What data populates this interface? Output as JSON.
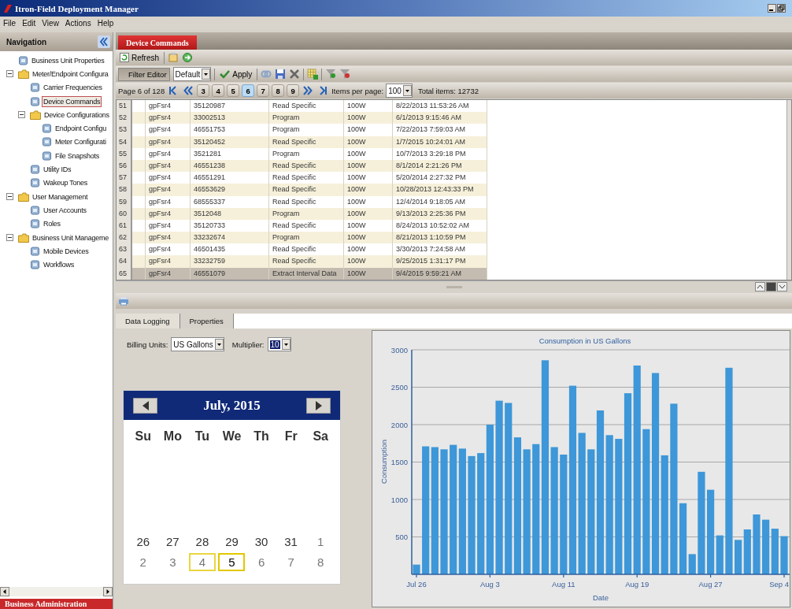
{
  "window": {
    "title": "Itron-Field Deployment Manager"
  },
  "menu": [
    "File",
    "Edit",
    "View",
    "Actions",
    "Help"
  ],
  "sidebar": {
    "title": "Navigation",
    "items": [
      {
        "label": "Business Unit Properties",
        "selected": false
      },
      {
        "label": "Meter/Endpoint Configura",
        "selected": false,
        "expanded": true,
        "children": [
          {
            "label": "Carrier Frequencies",
            "selected": false
          },
          {
            "label": "Device Commands",
            "selected": true
          },
          {
            "label": "Device Configurations",
            "selected": false,
            "expanded": true,
            "children": [
              {
                "label": "Endpoint Configu",
                "selected": false
              },
              {
                "label": "Meter Configurati",
                "selected": false
              },
              {
                "label": "File Snapshots",
                "selected": false
              }
            ]
          },
          {
            "label": "Utility IDs",
            "selected": false
          },
          {
            "label": "Wakeup Tones",
            "selected": false
          }
        ]
      },
      {
        "label": "User Management",
        "selected": false,
        "expanded": true,
        "children": [
          {
            "label": "User Accounts",
            "selected": false
          },
          {
            "label": "Roles",
            "selected": false
          }
        ]
      },
      {
        "label": "Business Unit Manageme",
        "selected": false,
        "expanded": true,
        "children": [
          {
            "label": "Mobile Devices",
            "selected": false
          },
          {
            "label": "Workflows",
            "selected": false
          }
        ]
      }
    ],
    "footer": "Business Administration"
  },
  "tabs": [
    {
      "label": "Device Commands",
      "selected": true
    }
  ],
  "toolbar": {
    "refresh": "Refresh"
  },
  "filter_bar": {
    "filter_editor": "Filter Editor",
    "preset": "Default",
    "apply": "Apply"
  },
  "pager": {
    "page_label": "Page 6 of 128",
    "pages": [
      {
        "label": "3",
        "selected": false
      },
      {
        "label": "4",
        "selected": false
      },
      {
        "label": "5",
        "selected": false
      },
      {
        "label": "6",
        "selected": true
      },
      {
        "label": "7",
        "selected": false
      },
      {
        "label": "8",
        "selected": false
      },
      {
        "label": "9",
        "selected": false
      }
    ],
    "items_per_page_label": "Items per page:",
    "items_per_page": "100",
    "total": "Total items:  12732"
  },
  "table": {
    "rows": [
      {
        "cells": [
          "51",
          "gpFsr4",
          "35120987",
          "Read Specific",
          "100W",
          "8/22/2013 11:53:26 AM"
        ],
        "selected": false
      },
      {
        "cells": [
          "52",
          "gpFsr4",
          "33002513",
          "Program",
          "100W",
          "6/1/2013 9:15:46 AM"
        ],
        "selected": false
      },
      {
        "cells": [
          "53",
          "gpFsr4",
          "46551753",
          "Program",
          "100W",
          "7/22/2013 7:59:03 AM"
        ],
        "selected": false
      },
      {
        "cells": [
          "54",
          "gpFsr4",
          "35120452",
          "Read Specific",
          "100W",
          "1/7/2015 10:24:01 AM"
        ],
        "selected": false
      },
      {
        "cells": [
          "55",
          "gpFsr4",
          "3521281",
          "Program",
          "100W",
          "10/7/2013 3:29:18 PM"
        ],
        "selected": false
      },
      {
        "cells": [
          "56",
          "gpFsr4",
          "46551238",
          "Read Specific",
          "100W",
          "8/1/2014 2:21:26 PM"
        ],
        "selected": false
      },
      {
        "cells": [
          "57",
          "gpFsr4",
          "46551291",
          "Read Specific",
          "100W",
          "5/20/2014 2:27:32 PM"
        ],
        "selected": false
      },
      {
        "cells": [
          "58",
          "gpFsr4",
          "46553629",
          "Read Specific",
          "100W",
          "10/28/2013 12:43:33 PM"
        ],
        "selected": false
      },
      {
        "cells": [
          "59",
          "gpFsr4",
          "68555337",
          "Read Specific",
          "100W",
          "12/4/2014 9:18:05 AM"
        ],
        "selected": false
      },
      {
        "cells": [
          "60",
          "gpFsr4",
          "3512048",
          "Program",
          "100W",
          "9/13/2013 2:25:36 PM"
        ],
        "selected": false
      },
      {
        "cells": [
          "61",
          "gpFsr4",
          "35120733",
          "Read Specific",
          "100W",
          "8/24/2013 10:52:02 AM"
        ],
        "selected": false
      },
      {
        "cells": [
          "62",
          "gpFsr4",
          "33232674",
          "Program",
          "100W",
          "8/21/2013 1:10:59 PM"
        ],
        "selected": false
      },
      {
        "cells": [
          "63",
          "gpFsr4",
          "46501435",
          "Read Specific",
          "100W",
          "3/30/2013 7:24:58 AM"
        ],
        "selected": false
      },
      {
        "cells": [
          "64",
          "gpFsr4",
          "33232759",
          "Read Specific",
          "100W",
          "9/25/2015 1:31:17 PM"
        ],
        "selected": false
      },
      {
        "cells": [
          "65",
          "gpFsr4",
          "46551079",
          "Extract Interval Data",
          "100W",
          "9/4/2015 9:59:21 AM"
        ],
        "selected": true
      }
    ]
  },
  "detail_tabs": [
    {
      "label": "Data Logging",
      "selected": true
    },
    {
      "label": "Properties",
      "selected": false
    }
  ],
  "billing": {
    "units_label": "Billing Units:",
    "units": "US Gallons",
    "multiplier_label": "Multiplier:",
    "multiplier": "10"
  },
  "calendar": {
    "title": "July, 2015",
    "weekdays": [
      "Su",
      "Mo",
      "Tu",
      "We",
      "Th",
      "Fr",
      "Sa"
    ],
    "days": [
      {
        "day": "26",
        "muted": false,
        "selected": false,
        "marked": false
      },
      {
        "day": "27",
        "muted": false,
        "selected": false,
        "marked": false
      },
      {
        "day": "28",
        "muted": false,
        "selected": false,
        "marked": false
      },
      {
        "day": "29",
        "muted": false,
        "selected": false,
        "marked": false
      },
      {
        "day": "30",
        "muted": false,
        "selected": false,
        "marked": false
      },
      {
        "day": "31",
        "muted": false,
        "selected": false,
        "marked": false
      },
      {
        "day": "1",
        "muted": true,
        "selected": false,
        "marked": false
      },
      {
        "day": "2",
        "muted": true,
        "selected": false,
        "marked": false
      },
      {
        "day": "3",
        "muted": true,
        "selected": false,
        "marked": false
      },
      {
        "day": "4",
        "muted": true,
        "selected": false,
        "marked": true
      },
      {
        "day": "5",
        "muted": false,
        "selected": true,
        "marked": true
      },
      {
        "day": "6",
        "muted": true,
        "selected": false,
        "marked": false
      },
      {
        "day": "7",
        "muted": true,
        "selected": false,
        "marked": false
      },
      {
        "day": "8",
        "muted": true,
        "selected": false,
        "marked": false
      }
    ]
  },
  "chart": {
    "chart_data": {
      "type": "bar",
      "title": "Consumption in US Gallons",
      "xlabel": "Date",
      "ylabel": "Consumption",
      "categories": [
        "Jul 26",
        null,
        null,
        null,
        null,
        null,
        null,
        null,
        "Aug 3",
        null,
        null,
        null,
        null,
        null,
        null,
        null,
        "Aug 11",
        null,
        null,
        null,
        null,
        null,
        null,
        null,
        "Aug 19",
        null,
        null,
        null,
        null,
        null,
        null,
        null,
        "Aug 27",
        null,
        null,
        null,
        null,
        null,
        null,
        null,
        "Sep 4"
      ],
      "values": [
        130,
        1710,
        1700,
        1670,
        1730,
        1680,
        1580,
        1620,
        2000,
        2320,
        2290,
        1830,
        1670,
        1740,
        2860,
        1700,
        1600,
        2520,
        1890,
        1670,
        2190,
        1860,
        1810,
        2420,
        2790,
        1940,
        2690,
        1590,
        2280,
        950,
        270,
        1370,
        1130,
        520,
        2760,
        460,
        600,
        800,
        730,
        610,
        510
      ],
      "ylim": [
        0,
        3000
      ],
      "yticks": [
        500,
        1000,
        1500,
        2000,
        2500,
        3000
      ],
      "grid": true
    }
  }
}
